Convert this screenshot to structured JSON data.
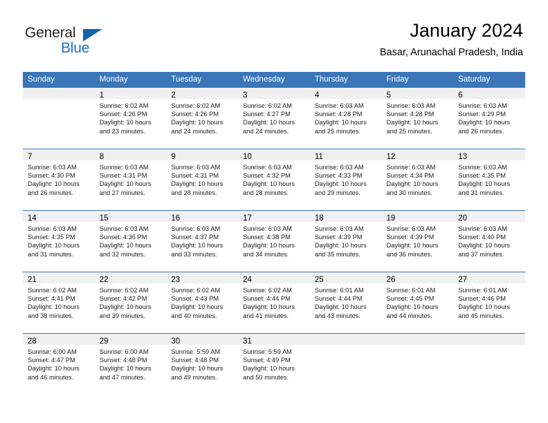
{
  "brand": {
    "name_part1": "General",
    "name_part2": "Blue",
    "triangle_color": "#1565a8",
    "blue_color": "#1873c4"
  },
  "header": {
    "title": "January 2024",
    "subtitle": "Basar, Arunachal Pradesh, India"
  },
  "theme": {
    "header_row_bg": "#3a76b8",
    "daynum_band_bg": "#f0f0f0",
    "row_divider": "#3a76b8",
    "text": "#000000"
  },
  "calendar": {
    "weekday_headers": [
      "Sunday",
      "Monday",
      "Tuesday",
      "Wednesday",
      "Thursday",
      "Friday",
      "Saturday"
    ],
    "weeks": [
      [
        {
          "day": "",
          "lines": []
        },
        {
          "day": "1",
          "lines": [
            "Sunrise: 6:02 AM",
            "Sunset: 4:26 PM",
            "Daylight: 10 hours",
            "and 23 minutes."
          ]
        },
        {
          "day": "2",
          "lines": [
            "Sunrise: 6:02 AM",
            "Sunset: 4:26 PM",
            "Daylight: 10 hours",
            "and 24 minutes."
          ]
        },
        {
          "day": "3",
          "lines": [
            "Sunrise: 6:02 AM",
            "Sunset: 4:27 PM",
            "Daylight: 10 hours",
            "and 24 minutes."
          ]
        },
        {
          "day": "4",
          "lines": [
            "Sunrise: 6:03 AM",
            "Sunset: 4:28 PM",
            "Daylight: 10 hours",
            "and 25 minutes."
          ]
        },
        {
          "day": "5",
          "lines": [
            "Sunrise: 6:03 AM",
            "Sunset: 4:28 PM",
            "Daylight: 10 hours",
            "and 25 minutes."
          ]
        },
        {
          "day": "6",
          "lines": [
            "Sunrise: 6:03 AM",
            "Sunset: 4:29 PM",
            "Daylight: 10 hours",
            "and 26 minutes."
          ]
        }
      ],
      [
        {
          "day": "7",
          "lines": [
            "Sunrise: 6:03 AM",
            "Sunset: 4:30 PM",
            "Daylight: 10 hours",
            "and 26 minutes."
          ]
        },
        {
          "day": "8",
          "lines": [
            "Sunrise: 6:03 AM",
            "Sunset: 4:31 PM",
            "Daylight: 10 hours",
            "and 27 minutes."
          ]
        },
        {
          "day": "9",
          "lines": [
            "Sunrise: 6:03 AM",
            "Sunset: 4:31 PM",
            "Daylight: 10 hours",
            "and 28 minutes."
          ]
        },
        {
          "day": "10",
          "lines": [
            "Sunrise: 6:03 AM",
            "Sunset: 4:32 PM",
            "Daylight: 10 hours",
            "and 28 minutes."
          ]
        },
        {
          "day": "11",
          "lines": [
            "Sunrise: 6:03 AM",
            "Sunset: 4:33 PM",
            "Daylight: 10 hours",
            "and 29 minutes."
          ]
        },
        {
          "day": "12",
          "lines": [
            "Sunrise: 6:03 AM",
            "Sunset: 4:34 PM",
            "Daylight: 10 hours",
            "and 30 minutes."
          ]
        },
        {
          "day": "13",
          "lines": [
            "Sunrise: 6:03 AM",
            "Sunset: 4:35 PM",
            "Daylight: 10 hours",
            "and 31 minutes."
          ]
        }
      ],
      [
        {
          "day": "14",
          "lines": [
            "Sunrise: 6:03 AM",
            "Sunset: 4:35 PM",
            "Daylight: 10 hours",
            "and 31 minutes."
          ]
        },
        {
          "day": "15",
          "lines": [
            "Sunrise: 6:03 AM",
            "Sunset: 4:36 PM",
            "Daylight: 10 hours",
            "and 32 minutes."
          ]
        },
        {
          "day": "16",
          "lines": [
            "Sunrise: 6:03 AM",
            "Sunset: 4:37 PM",
            "Daylight: 10 hours",
            "and 33 minutes."
          ]
        },
        {
          "day": "17",
          "lines": [
            "Sunrise: 6:03 AM",
            "Sunset: 4:38 PM",
            "Daylight: 10 hours",
            "and 34 minutes."
          ]
        },
        {
          "day": "18",
          "lines": [
            "Sunrise: 6:03 AM",
            "Sunset: 4:39 PM",
            "Daylight: 10 hours",
            "and 35 minutes."
          ]
        },
        {
          "day": "19",
          "lines": [
            "Sunrise: 6:03 AM",
            "Sunset: 4:39 PM",
            "Daylight: 10 hours",
            "and 36 minutes."
          ]
        },
        {
          "day": "20",
          "lines": [
            "Sunrise: 6:03 AM",
            "Sunset: 4:40 PM",
            "Daylight: 10 hours",
            "and 37 minutes."
          ]
        }
      ],
      [
        {
          "day": "21",
          "lines": [
            "Sunrise: 6:02 AM",
            "Sunset: 4:41 PM",
            "Daylight: 10 hours",
            "and 38 minutes."
          ]
        },
        {
          "day": "22",
          "lines": [
            "Sunrise: 6:02 AM",
            "Sunset: 4:42 PM",
            "Daylight: 10 hours",
            "and 39 minutes."
          ]
        },
        {
          "day": "23",
          "lines": [
            "Sunrise: 6:02 AM",
            "Sunset: 4:43 PM",
            "Daylight: 10 hours",
            "and 40 minutes."
          ]
        },
        {
          "day": "24",
          "lines": [
            "Sunrise: 6:02 AM",
            "Sunset: 4:44 PM",
            "Daylight: 10 hours",
            "and 41 minutes."
          ]
        },
        {
          "day": "25",
          "lines": [
            "Sunrise: 6:01 AM",
            "Sunset: 4:44 PM",
            "Daylight: 10 hours",
            "and 43 minutes."
          ]
        },
        {
          "day": "26",
          "lines": [
            "Sunrise: 6:01 AM",
            "Sunset: 4:45 PM",
            "Daylight: 10 hours",
            "and 44 minutes."
          ]
        },
        {
          "day": "27",
          "lines": [
            "Sunrise: 6:01 AM",
            "Sunset: 4:46 PM",
            "Daylight: 10 hours",
            "and 45 minutes."
          ]
        }
      ],
      [
        {
          "day": "28",
          "lines": [
            "Sunrise: 6:00 AM",
            "Sunset: 4:47 PM",
            "Daylight: 10 hours",
            "and 46 minutes."
          ]
        },
        {
          "day": "29",
          "lines": [
            "Sunrise: 6:00 AM",
            "Sunset: 4:48 PM",
            "Daylight: 10 hours",
            "and 47 minutes."
          ]
        },
        {
          "day": "30",
          "lines": [
            "Sunrise: 5:59 AM",
            "Sunset: 4:48 PM",
            "Daylight: 10 hours",
            "and 49 minutes."
          ]
        },
        {
          "day": "31",
          "lines": [
            "Sunrise: 5:59 AM",
            "Sunset: 4:49 PM",
            "Daylight: 10 hours",
            "and 50 minutes."
          ]
        },
        {
          "day": "",
          "lines": []
        },
        {
          "day": "",
          "lines": []
        },
        {
          "day": "",
          "lines": []
        }
      ]
    ]
  }
}
